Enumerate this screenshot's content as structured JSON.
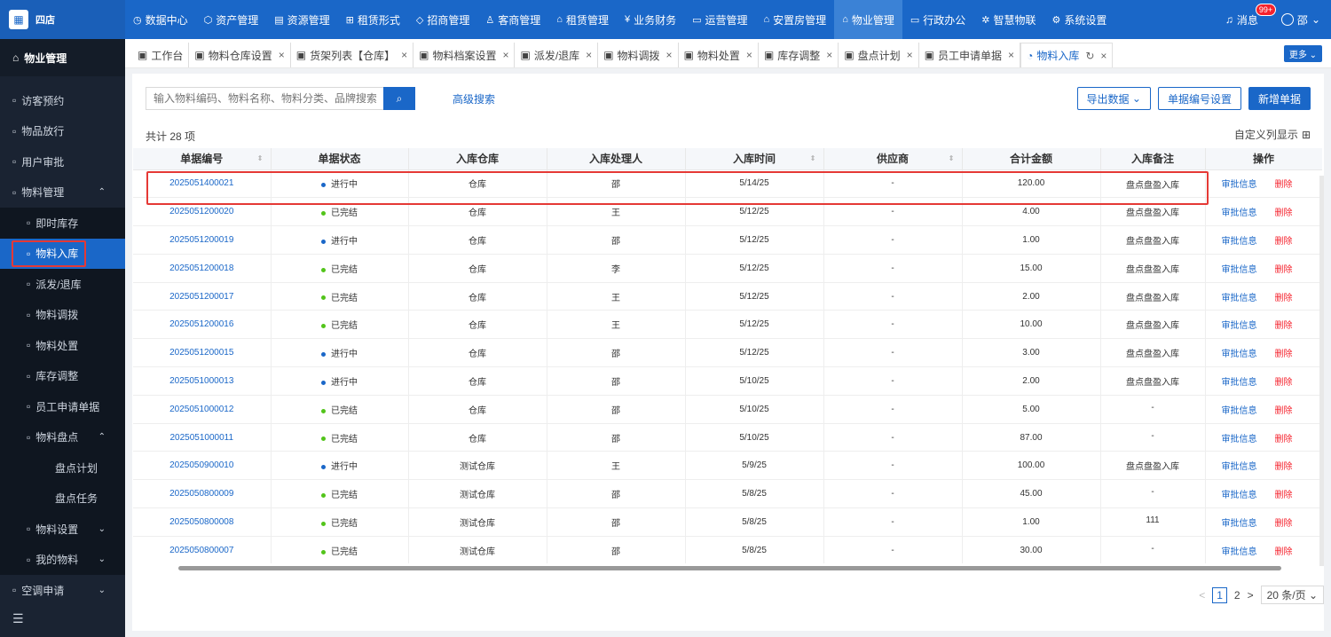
{
  "brand": {
    "name": "四店"
  },
  "nav": [
    {
      "icon": "◷",
      "label": "数据中心"
    },
    {
      "icon": "⬡",
      "label": "资产管理"
    },
    {
      "icon": "▤",
      "label": "资源管理"
    },
    {
      "icon": "⊞",
      "label": "租赁形式"
    },
    {
      "icon": "◇",
      "label": "招商管理"
    },
    {
      "icon": "♙",
      "label": "客商管理"
    },
    {
      "icon": "⌂",
      "label": "租赁管理"
    },
    {
      "icon": "¥",
      "label": "业务财务"
    },
    {
      "icon": "▭",
      "label": "运营管理"
    },
    {
      "icon": "⌂",
      "label": "安置房管理"
    },
    {
      "icon": "⌂",
      "label": "物业管理"
    },
    {
      "icon": "▭",
      "label": "行政办公"
    },
    {
      "icon": "✲",
      "label": "智慧物联"
    },
    {
      "icon": "⚙",
      "label": "系统设置"
    }
  ],
  "topRight": {
    "message": "消息",
    "badge": "99+",
    "user": "邵"
  },
  "sidebar": {
    "header": "物业管理",
    "items": [
      {
        "label": "访客预约",
        "level": 0
      },
      {
        "label": "物品放行",
        "level": 0
      },
      {
        "label": "用户审批",
        "level": 0
      },
      {
        "label": "物料管理",
        "level": 0,
        "arrow": "⌃"
      },
      {
        "label": "即时库存",
        "level": 1
      },
      {
        "label": "物料入库",
        "level": 1,
        "active": true
      },
      {
        "label": "派发/退库",
        "level": 1
      },
      {
        "label": "物料调拨",
        "level": 1
      },
      {
        "label": "物料处置",
        "level": 1
      },
      {
        "label": "库存调整",
        "level": 1
      },
      {
        "label": "员工申请单据",
        "level": 1
      },
      {
        "label": "物料盘点",
        "level": 1,
        "arrow": "⌃"
      },
      {
        "label": "盘点计划",
        "level": 2
      },
      {
        "label": "盘点任务",
        "level": 2
      },
      {
        "label": "物料设置",
        "level": 1,
        "arrow": "⌄"
      },
      {
        "label": "我的物料",
        "level": 1,
        "arrow": "⌄"
      },
      {
        "label": "空调申请",
        "level": 0,
        "arrow": "⌄"
      }
    ]
  },
  "tabs": [
    {
      "label": "工作台",
      "closable": false
    },
    {
      "label": "物料仓库设置",
      "closable": true
    },
    {
      "label": "货架列表【仓库】",
      "closable": true
    },
    {
      "label": "物料档案设置",
      "closable": true
    },
    {
      "label": "派发/退库",
      "closable": true
    },
    {
      "label": "物料调拨",
      "closable": true
    },
    {
      "label": "物料处置",
      "closable": true
    },
    {
      "label": "库存调整",
      "closable": true
    },
    {
      "label": "盘点计划",
      "closable": true
    },
    {
      "label": "员工申请单据",
      "closable": true
    },
    {
      "label": "物料入库",
      "closable": true,
      "active": true
    }
  ],
  "moreLabel": "更多 ⌄",
  "search": {
    "placeholder": "输入物料编码、物料名称、物料分类、品牌搜索",
    "advanced": "高级搜索"
  },
  "actions": {
    "export": "导出数据",
    "numbering": "单据编号设置",
    "add": "新增单据"
  },
  "total": "共计 28 项",
  "customCols": "自定义列显示",
  "columns": [
    "单据编号",
    "单据状态",
    "入库仓库",
    "入库处理人",
    "入库时间",
    "供应商",
    "合计金额",
    "入库备注",
    "操作"
  ],
  "rows": [
    {
      "code": "2025051400021",
      "status": "进行中",
      "s": "run",
      "wh": "仓库",
      "handler": "邵",
      "time": "5/14/25",
      "supplier": "-",
      "amount": "120.00",
      "note": "盘点盘盈入库"
    },
    {
      "code": "2025051200020",
      "status": "已完结",
      "s": "done",
      "wh": "仓库",
      "handler": "王",
      "time": "5/12/25",
      "supplier": "-",
      "amount": "4.00",
      "note": "盘点盘盈入库"
    },
    {
      "code": "2025051200019",
      "status": "进行中",
      "s": "run",
      "wh": "仓库",
      "handler": "邵",
      "time": "5/12/25",
      "supplier": "-",
      "amount": "1.00",
      "note": "盘点盘盈入库"
    },
    {
      "code": "2025051200018",
      "status": "已完结",
      "s": "done",
      "wh": "仓库",
      "handler": "李",
      "time": "5/12/25",
      "supplier": "-",
      "amount": "15.00",
      "note": "盘点盘盈入库"
    },
    {
      "code": "2025051200017",
      "status": "已完结",
      "s": "done",
      "wh": "仓库",
      "handler": "王",
      "time": "5/12/25",
      "supplier": "-",
      "amount": "2.00",
      "note": "盘点盘盈入库"
    },
    {
      "code": "2025051200016",
      "status": "已完结",
      "s": "done",
      "wh": "仓库",
      "handler": "王",
      "time": "5/12/25",
      "supplier": "-",
      "amount": "10.00",
      "note": "盘点盘盈入库"
    },
    {
      "code": "2025051200015",
      "status": "进行中",
      "s": "run",
      "wh": "仓库",
      "handler": "邵",
      "time": "5/12/25",
      "supplier": "-",
      "amount": "3.00",
      "note": "盘点盘盈入库"
    },
    {
      "code": "2025051000013",
      "status": "进行中",
      "s": "run",
      "wh": "仓库",
      "handler": "邵",
      "time": "5/10/25",
      "supplier": "-",
      "amount": "2.00",
      "note": "盘点盘盈入库"
    },
    {
      "code": "2025051000012",
      "status": "已完结",
      "s": "done",
      "wh": "仓库",
      "handler": "邵",
      "time": "5/10/25",
      "supplier": "-",
      "amount": "5.00",
      "note": "-"
    },
    {
      "code": "2025051000011",
      "status": "已完结",
      "s": "done",
      "wh": "仓库",
      "handler": "邵",
      "time": "5/10/25",
      "supplier": "-",
      "amount": "87.00",
      "note": "-"
    },
    {
      "code": "2025050900010",
      "status": "进行中",
      "s": "run",
      "wh": "测试仓库",
      "handler": "王",
      "time": "5/9/25",
      "supplier": "-",
      "amount": "100.00",
      "note": "盘点盘盈入库"
    },
    {
      "code": "2025050800009",
      "status": "已完结",
      "s": "done",
      "wh": "测试仓库",
      "handler": "邵",
      "time": "5/8/25",
      "supplier": "-",
      "amount": "45.00",
      "note": "-"
    },
    {
      "code": "2025050800008",
      "status": "已完结",
      "s": "done",
      "wh": "测试仓库",
      "handler": "邵",
      "time": "5/8/25",
      "supplier": "-",
      "amount": "1.00",
      "note": "111"
    },
    {
      "code": "2025050800007",
      "status": "已完结",
      "s": "done",
      "wh": "测试仓库",
      "handler": "邵",
      "time": "5/8/25",
      "supplier": "-",
      "amount": "30.00",
      "note": "-"
    }
  ],
  "ops": {
    "approve": "审批信息",
    "delete": "删除"
  },
  "pager": {
    "prev": "<",
    "pages": [
      "1",
      "2"
    ],
    "next": ">",
    "size": "20 条/页 ⌄"
  }
}
